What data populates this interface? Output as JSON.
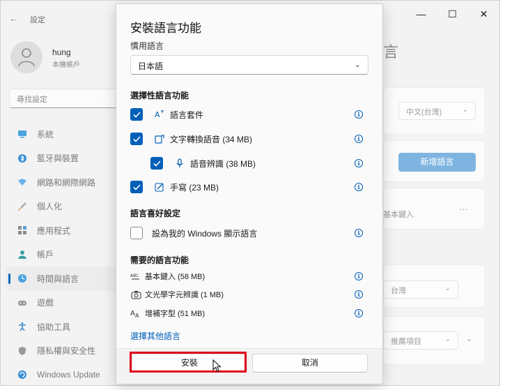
{
  "window": {
    "title": "設定",
    "back_glyph": "←",
    "controls": {
      "minimize": "—",
      "maximize": "☐",
      "close": "✕"
    }
  },
  "user": {
    "name": "hung",
    "account": "本機帳戶"
  },
  "search": {
    "placeholder": "尋找設定"
  },
  "sidebar": {
    "items": [
      {
        "label": "系統",
        "icon": "monitor-icon"
      },
      {
        "label": "藍牙與裝置",
        "icon": "bluetooth-icon"
      },
      {
        "label": "網路和網際網路",
        "icon": "wifi-icon"
      },
      {
        "label": "個人化",
        "icon": "brush-icon"
      },
      {
        "label": "應用程式",
        "icon": "apps-icon"
      },
      {
        "label": "帳戶",
        "icon": "person-icon"
      },
      {
        "label": "時間與語言",
        "icon": "globe-clock-icon",
        "active": true
      },
      {
        "label": "遊戲",
        "icon": "gamepad-icon"
      },
      {
        "label": "協助工具",
        "icon": "accessibility-icon"
      },
      {
        "label": "隱私權與安全性",
        "icon": "shield-icon"
      },
      {
        "label": "Windows Update",
        "icon": "update-icon"
      }
    ]
  },
  "background": {
    "title_fragment": "言",
    "region_dropdown": "中文(台灣)",
    "add_language_button": "新增語言",
    "keyboard_fragment": "基本鍵入",
    "more": "···",
    "country_dropdown": "台灣",
    "format_dropdown": "推薦項目"
  },
  "dialog": {
    "title": "安裝語言功能",
    "preferred_label": "慣用語言",
    "selected_language": "日本語",
    "optional_section": "選擇性語言功能",
    "optional_features": [
      {
        "label": "語言套件",
        "checked": true,
        "icon": "language-pack-icon"
      },
      {
        "label": "文字轉換語音 (34 MB)",
        "checked": true,
        "icon": "text-to-speech-icon"
      },
      {
        "label": "語音辨識 (38 MB)",
        "checked": true,
        "icon": "microphone-icon"
      },
      {
        "label": "手寫 (23 MB)",
        "checked": true,
        "icon": "pen-icon"
      }
    ],
    "preferences_section": "語言喜好設定",
    "display_language": {
      "label": "設為我的 Windows 顯示語言",
      "checked": false
    },
    "required_section": "需要的語言功能",
    "required_features": [
      {
        "label": "基本鍵入 (58 MB)",
        "icon": "abc-typing-icon"
      },
      {
        "label": "文光學字元辨識 (1 MB)",
        "icon": "camera-ocr-icon"
      },
      {
        "label": "增補字型 (51 MB)",
        "icon": "font-icon"
      }
    ],
    "more_languages_link": "選擇其他語言",
    "install_button": "安裝",
    "cancel_button": "取消",
    "info_glyph": "i"
  }
}
